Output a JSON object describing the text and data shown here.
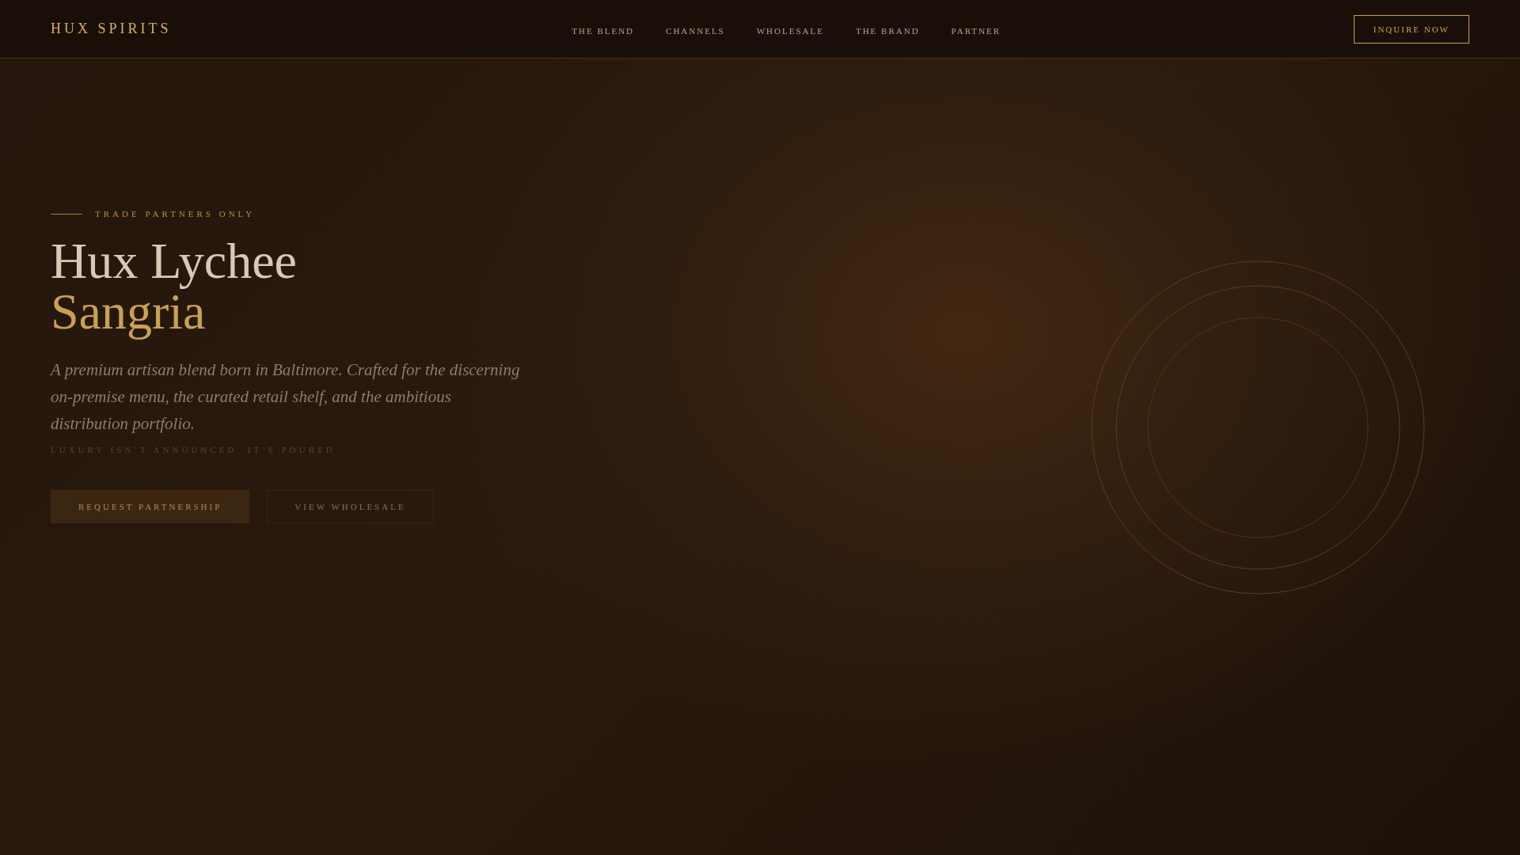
{
  "header": {
    "logo": "HUX SPIRITS",
    "nav": [
      {
        "label": "THE BLEND"
      },
      {
        "label": "CHANNELS"
      },
      {
        "label": "WHOLESALE"
      },
      {
        "label": "THE BRAND"
      },
      {
        "label": "PARTNER"
      }
    ],
    "cta": "INQUIRE NOW"
  },
  "hero": {
    "eyebrow": "TRADE PARTNERS ONLY",
    "title_line_1": "Hux Lychee",
    "title_line_2": "Sangria",
    "description": "A premium artisan blend born in Baltimore. Crafted for the discerning on-premise menu, the curated retail shelf, and the ambitious distribution portfolio.",
    "tagline": "LUXURY ISN’T ANNOUNCED. IT’S POURED.",
    "buttons": [
      {
        "label": "REQUEST PARTNERSHIP",
        "kind": "primary"
      },
      {
        "label": "VIEW WHOLESALE",
        "kind": "secondary"
      }
    ]
  }
}
